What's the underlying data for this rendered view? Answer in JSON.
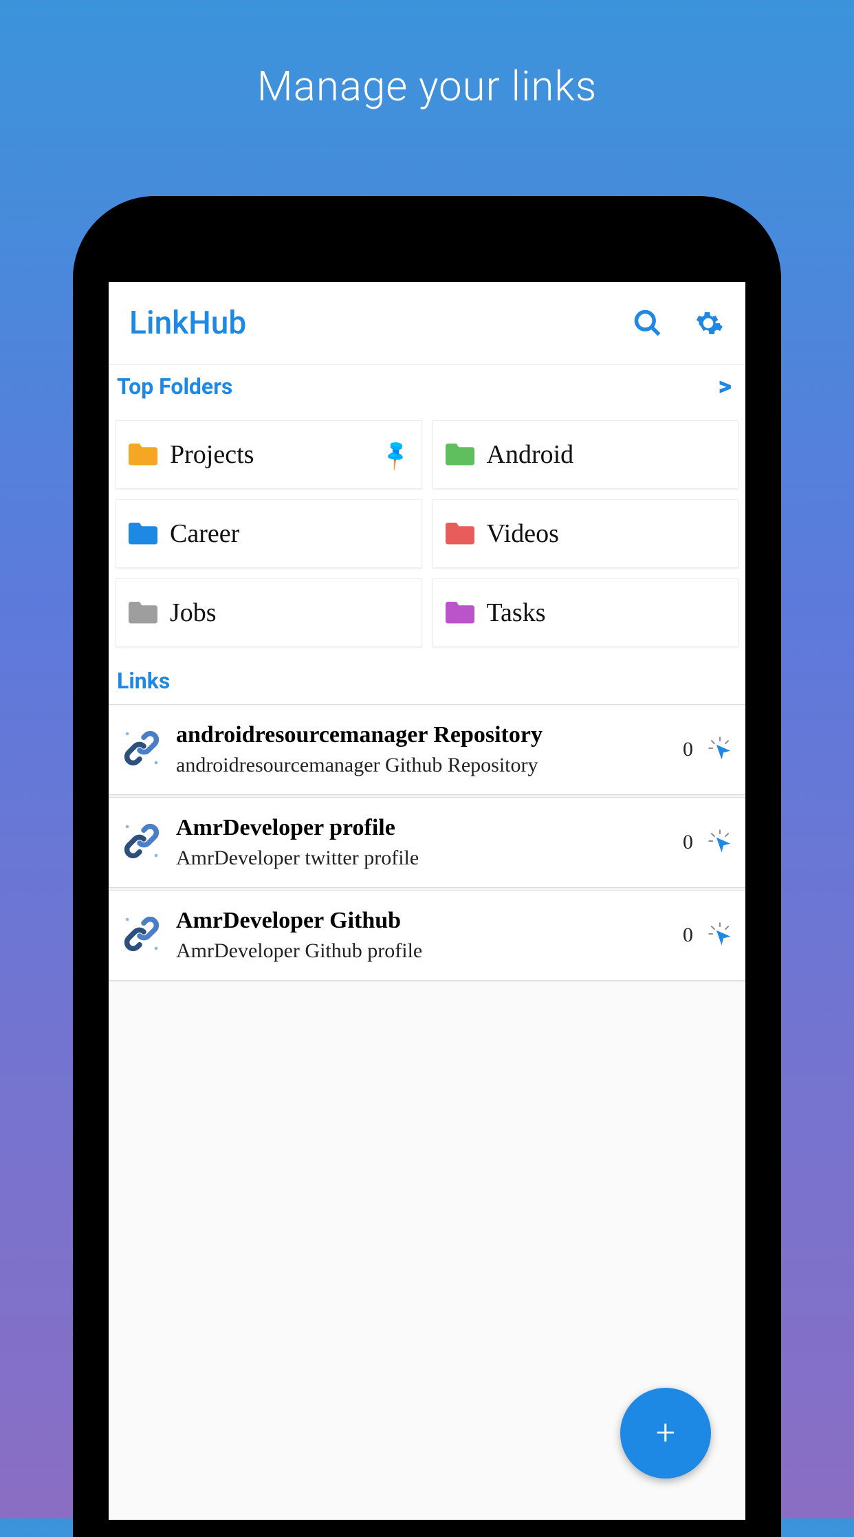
{
  "promoTitle": "Manage your links",
  "appTitle": "LinkHub",
  "sections": {
    "topFolders": "Top Folders",
    "links": "Links"
  },
  "folders": [
    {
      "label": "Projects",
      "color": "#f5a623",
      "pinned": true
    },
    {
      "label": "Android",
      "color": "#5fbf5f",
      "pinned": false
    },
    {
      "label": "Career",
      "color": "#1e88e5",
      "pinned": false
    },
    {
      "label": "Videos",
      "color": "#e85c5c",
      "pinned": false
    },
    {
      "label": "Jobs",
      "color": "#9e9e9e",
      "pinned": false
    },
    {
      "label": "Tasks",
      "color": "#b954c9",
      "pinned": false
    }
  ],
  "links": [
    {
      "title": "androidresourcemanager Repository",
      "subtitle": "androidresourcemanager Github Repository",
      "count": "0"
    },
    {
      "title": "AmrDeveloper profile",
      "subtitle": "AmrDeveloper twitter profile",
      "count": "0"
    },
    {
      "title": "AmrDeveloper Github",
      "subtitle": "AmrDeveloper Github profile",
      "count": "0"
    }
  ]
}
